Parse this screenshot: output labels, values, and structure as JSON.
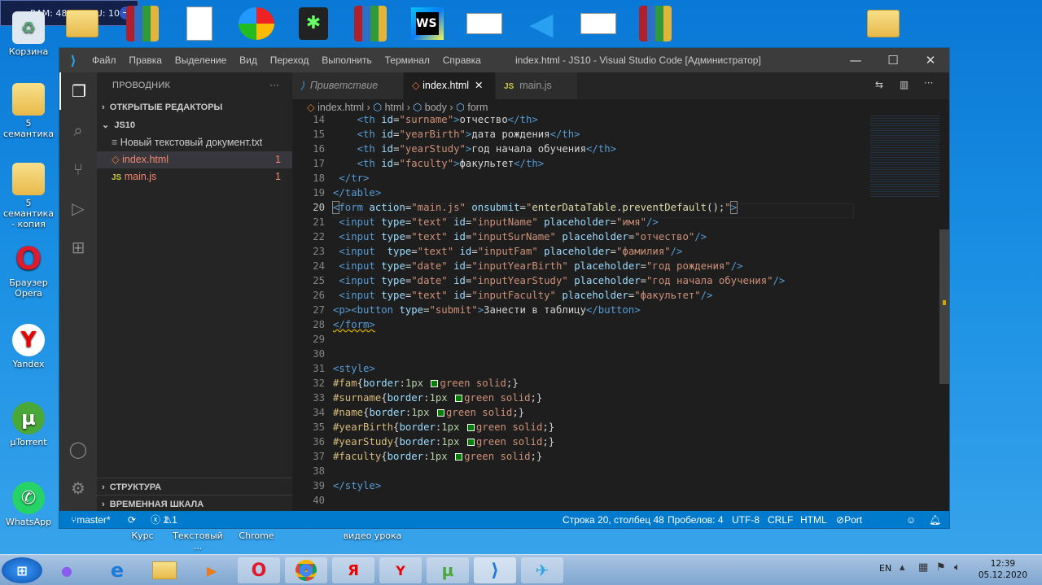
{
  "widget": {
    "ram": "RAM: 48 %",
    "cpu": "CPU: 10 %"
  },
  "desktop": {
    "left_icons": [
      {
        "label": "Корзина"
      },
      {
        "label": "5 семантика"
      },
      {
        "label": "5 семантика - копия"
      },
      {
        "label": "Браузер Opera"
      },
      {
        "label": "Yandex"
      },
      {
        "label": "μTorrent"
      },
      {
        "label": "WhatsApp"
      }
    ],
    "bottom_labels": [
      "Курс",
      "Текстовый ...",
      "Chrome",
      "видео урока"
    ]
  },
  "window": {
    "title": "index.html - JS10 - Visual Studio Code [Администратор]",
    "menu": [
      "Файл",
      "Правка",
      "Выделение",
      "Вид",
      "Переход",
      "Выполнить",
      "Терминал",
      "Справка"
    ]
  },
  "sidebar": {
    "header": "ПРОВОДНИК",
    "open_editors": "ОТКРЫТЫЕ РЕДАКТОРЫ",
    "folder": "JS10",
    "files": [
      {
        "name": "Новый текстовый документ.txt",
        "count": ""
      },
      {
        "name": "index.html",
        "count": "1"
      },
      {
        "name": "main.js",
        "count": "1"
      }
    ],
    "outline": "СТРУКТУРА",
    "timeline": "ВРЕМЕННАЯ ШКАЛА"
  },
  "tabs": [
    {
      "label": "Приветствие"
    },
    {
      "label": "index.html"
    },
    {
      "label": "main.js"
    }
  ],
  "breadcrumb": [
    "index.html",
    "html",
    "body",
    "form"
  ],
  "code": {
    "lines": [
      "14",
      "15",
      "16",
      "17",
      "18",
      "19",
      "20",
      "21",
      "22",
      "23",
      "24",
      "25",
      "26",
      "27",
      "28",
      "29",
      "30",
      "31",
      "32",
      "33",
      "34",
      "35",
      "36",
      "37",
      "38",
      "39",
      "40",
      "41"
    ]
  },
  "status": {
    "branch": "master*",
    "problems": "1",
    "warnings": "1",
    "position": "Строка 20, столбец 48",
    "spaces": "Пробелов: 4",
    "encoding": "UTF-8",
    "eol": "CRLF",
    "language": "HTML",
    "port": "Port : 5500"
  },
  "taskbar": {
    "lang": "EN",
    "time": "12:39",
    "date": "05.12.2020"
  }
}
